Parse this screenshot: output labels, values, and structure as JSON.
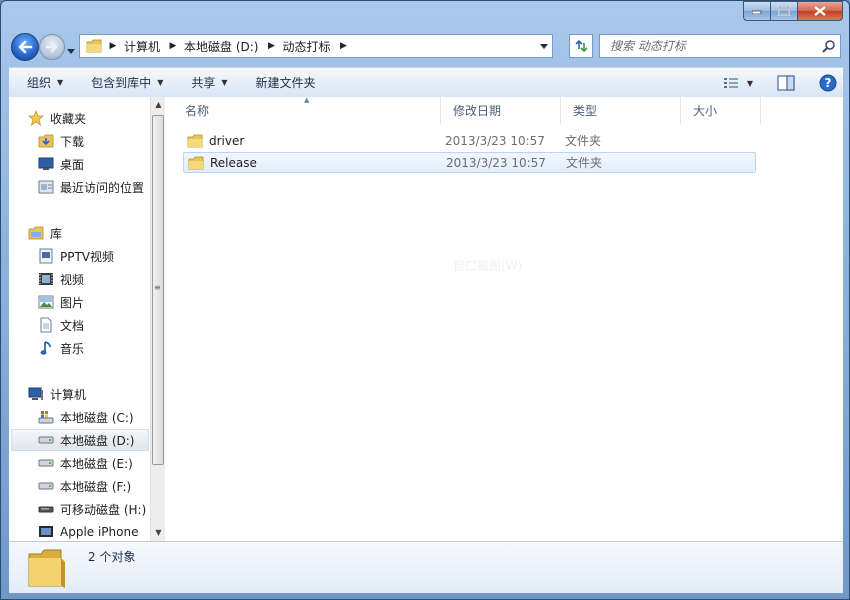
{
  "window": {
    "address": {
      "crumbs": [
        "计算机",
        "本地磁盘 (D:)",
        "动态打标"
      ]
    },
    "search": {
      "placeholder": "搜索 动态打标"
    }
  },
  "toolbar": {
    "organize": "组织",
    "include_in_library": "包含到库中",
    "share": "共享",
    "new_folder": "新建文件夹"
  },
  "navigation": {
    "favorites": {
      "label": "收藏夹",
      "items": [
        "下载",
        "桌面",
        "最近访问的位置"
      ]
    },
    "libraries": {
      "label": "库",
      "items": [
        "PPTV视频",
        "视频",
        "图片",
        "文档",
        "音乐"
      ]
    },
    "computer": {
      "label": "计算机",
      "items": [
        "本地磁盘 (C:)",
        "本地磁盘 (D:)",
        "本地磁盘 (E:)",
        "本地磁盘 (F:)",
        "可移动磁盘 (H:)",
        "Apple iPhone"
      ]
    },
    "selected": "本地磁盘 (D:)"
  },
  "columns": {
    "name": "名称",
    "modified": "修改日期",
    "type": "类型",
    "size": "大小"
  },
  "files": [
    {
      "name": "driver",
      "modified": "2013/3/23 10:57",
      "type": "文件夹"
    },
    {
      "name": "Release",
      "modified": "2013/3/23 10:57",
      "type": "文件夹"
    }
  ],
  "ghost_text": "窗口截图(W)",
  "status": {
    "count": "2 个对象"
  },
  "icons": [
    "back-arrow-icon",
    "forward-arrow-icon",
    "folder-icon",
    "refresh-icon",
    "search-icon",
    "view-icon",
    "preview-pane-icon",
    "help-icon",
    "star-icon",
    "download-icon",
    "desktop-icon",
    "recent-icon",
    "library-icon",
    "video-icon",
    "picture-icon",
    "document-icon",
    "music-icon",
    "computer-icon",
    "drive-icon",
    "phone-icon"
  ]
}
